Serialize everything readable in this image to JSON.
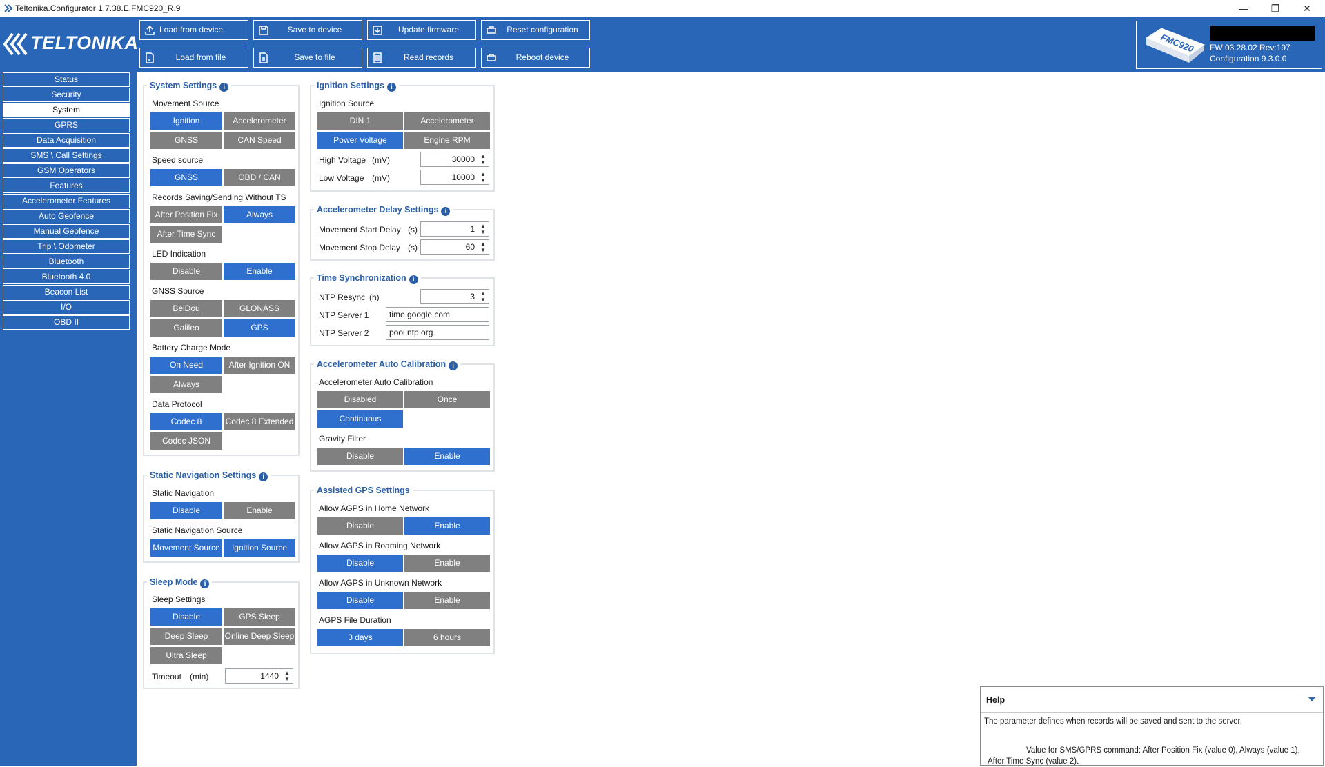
{
  "window": {
    "title": "Teltonika.Configurator 1.7.38.E.FMC920_R.9",
    "controls": {
      "minimize": "—",
      "restore": "❐",
      "close": "✕"
    }
  },
  "logo": {
    "text": "TELTONIKA"
  },
  "toolbar": {
    "load_device": "Load from device",
    "save_device": "Save to device",
    "update_fw": "Update firmware",
    "reset_cfg": "Reset configuration",
    "load_file": "Load from file",
    "save_file": "Save to file",
    "read_records": "Read records",
    "reboot": "Reboot device"
  },
  "device": {
    "model": "FMC920",
    "fw": "FW  03.28.02 Rev:197",
    "config": "Configuration  9.3.0.0"
  },
  "sidebar": {
    "items": [
      "Status",
      "Security",
      "System",
      "GPRS",
      "Data Acquisition",
      "SMS \\ Call Settings",
      "GSM Operators",
      "Features",
      "Accelerometer Features",
      "Auto Geofence",
      "Manual Geofence",
      "Trip \\ Odometer",
      "Bluetooth",
      "Bluetooth 4.0",
      "Beacon List",
      "I/O",
      "OBD II"
    ],
    "active": "System"
  },
  "system": {
    "title": "System Settings",
    "movement_source": {
      "label": "Movement Source",
      "opts": [
        "Ignition",
        "Accelerometer",
        "GNSS",
        "CAN Speed"
      ]
    },
    "speed_source": {
      "label": "Speed source",
      "opts": [
        "GNSS",
        "OBD / CAN"
      ]
    },
    "records": {
      "label": "Records Saving/Sending Without TS",
      "opts": [
        "After Position Fix",
        "Always",
        "After Time Sync"
      ]
    },
    "led": {
      "label": "LED Indication",
      "opts": [
        "Disable",
        "Enable"
      ]
    },
    "gnss": {
      "label": "GNSS Source",
      "opts": [
        "BeiDou",
        "GLONASS",
        "Galileo",
        "GPS"
      ]
    },
    "battery": {
      "label": "Battery Charge Mode",
      "opts": [
        "On Need",
        "After Ignition ON",
        "Always"
      ]
    },
    "protocol": {
      "label": "Data Protocol",
      "opts": [
        "Codec 8",
        "Codec 8 Extended",
        "Codec JSON"
      ]
    }
  },
  "static_nav": {
    "title": "Static Navigation Settings",
    "nav": {
      "label": "Static Navigation",
      "opts": [
        "Disable",
        "Enable"
      ]
    },
    "source": {
      "label": "Static Navigation Source",
      "opts": [
        "Movement Source",
        "Ignition Source"
      ]
    }
  },
  "sleep": {
    "title": "Sleep Mode",
    "label": "Sleep Settings",
    "opts": [
      "Disable",
      "GPS Sleep",
      "Deep Sleep",
      "Online Deep Sleep",
      "Ultra Sleep"
    ],
    "timeout_label": "Timeout",
    "timeout_unit": "(min)",
    "timeout_value": "1440"
  },
  "ignition": {
    "title": "Ignition Settings",
    "label": "Ignition Source",
    "opts": [
      "DIN 1",
      "Accelerometer",
      "Power Voltage",
      "Engine RPM"
    ],
    "high_label": "High Voltage",
    "high_unit": "(mV)",
    "high_value": "30000",
    "low_label": "Low Voltage",
    "low_unit": "(mV)",
    "low_value": "10000"
  },
  "accel_delay": {
    "title": "Accelerometer Delay Settings",
    "start_label": "Movement Start Delay",
    "start_unit": "(s)",
    "start_value": "1",
    "stop_label": "Movement Stop Delay",
    "stop_unit": "(s)",
    "stop_value": "60"
  },
  "time_sync": {
    "title": "Time Synchronization",
    "ntp_label": "NTP Resync",
    "ntp_unit": "(h)",
    "ntp_value": "3",
    "s1_label": "NTP Server 1",
    "s1_value": "time.google.com",
    "s2_label": "NTP Server 2",
    "s2_value": "pool.ntp.org"
  },
  "accel_cal": {
    "title": "Accelerometer Auto Calibration",
    "label": "Accelerometer Auto Calibration",
    "opts": [
      "Disabled",
      "Once",
      "Continuous"
    ],
    "gravity_label": "Gravity Filter",
    "gravity_opts": [
      "Disable",
      "Enable"
    ]
  },
  "agps": {
    "title": "Assisted GPS Settings",
    "home_label": "Allow AGPS in Home Network",
    "home_opts": [
      "Disable",
      "Enable"
    ],
    "roam_label": "Allow AGPS in Roaming Network",
    "roam_opts": [
      "Disable",
      "Enable"
    ],
    "unknown_label": "Allow AGPS in Unknown Network",
    "unknown_opts": [
      "Disable",
      "Enable"
    ],
    "dur_label": "AGPS File Duration",
    "dur_opts": [
      "3 days",
      "6 hours"
    ]
  },
  "help": {
    "title": "Help",
    "text1": "The parameter defines when records will be saved and sent to the server.",
    "text2": "Value for SMS/GPRS command: After Position Fix (value 0), Always (value 1), After Time Sync (value 2)."
  },
  "colors": {
    "brand": "#2a66b7",
    "selected": "#2f6fcd",
    "unselected": "#808080",
    "panel_title": "#2a5fa8"
  }
}
